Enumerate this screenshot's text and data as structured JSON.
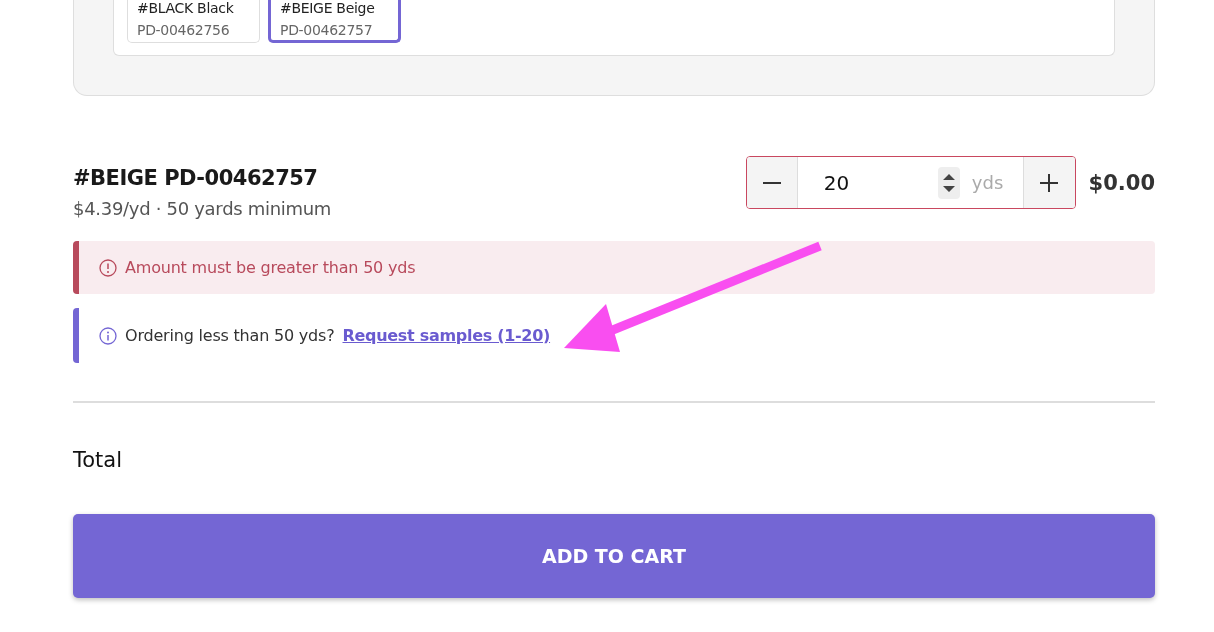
{
  "swatches": [
    {
      "name": "#BLACK Black",
      "code": "PD-00462756",
      "selected": false
    },
    {
      "name": "#BEIGE Beige",
      "code": "PD-00462757",
      "selected": true
    }
  ],
  "product": {
    "title": "#BEIGE PD-00462757",
    "price": "$4.39/yd · 50 yards minimum"
  },
  "quantity": {
    "value": "20",
    "unit": "yds",
    "invalid": true,
    "line_total": "$0.00"
  },
  "alerts": [
    {
      "kind": "error",
      "text": "Amount must be greater than 50 yds"
    },
    {
      "kind": "info",
      "text": "Ordering less than 50 yds?",
      "link": "Request samples (1-20)"
    }
  ],
  "total": {
    "label": "Total"
  },
  "cart_button": "ADD TO CART"
}
